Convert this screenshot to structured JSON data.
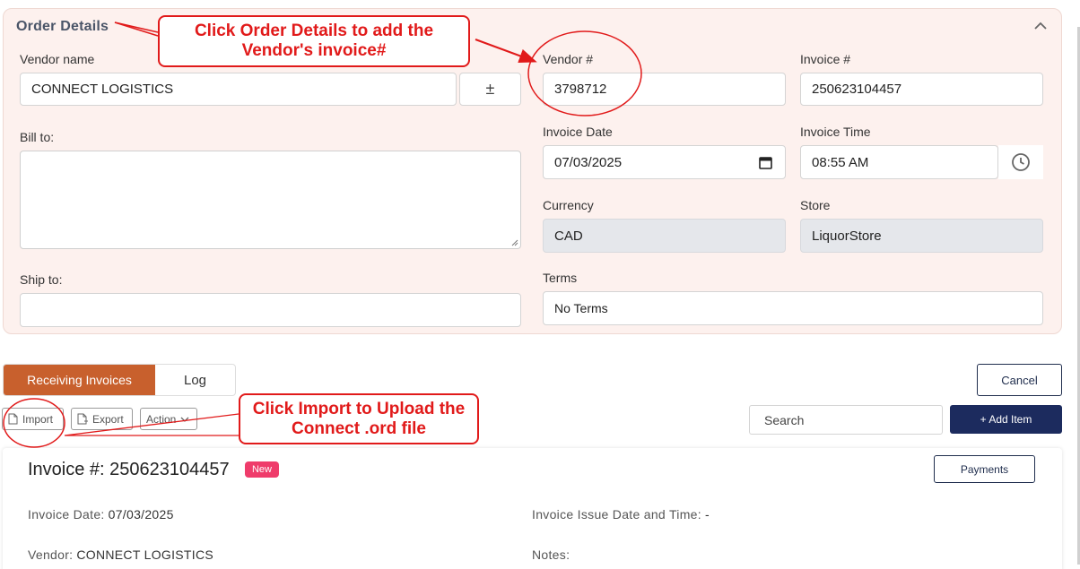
{
  "order_details": {
    "title": "Order Details",
    "vendor_name_label": "Vendor name",
    "vendor_name_value": "CONNECT LOGISTICS",
    "vendor_toggle_label": "±",
    "vendor_num_label": "Vendor #",
    "vendor_num_value": "3798712",
    "invoice_num_label": "Invoice #",
    "invoice_num_value": "250623104457",
    "bill_to_label": "Bill to:",
    "invoice_date_label": "Invoice Date",
    "invoice_date_value": "07/03/2025",
    "invoice_time_label": "Invoice Time",
    "invoice_time_value": "08:55 AM",
    "currency_label": "Currency",
    "currency_value": "CAD",
    "store_label": "Store",
    "store_value": "LiquorStore",
    "ship_to_label": "Ship to:",
    "terms_label": "Terms",
    "terms_value": "No Terms"
  },
  "tabs": [
    "Receiving Invoices",
    "Log"
  ],
  "toolbar": {
    "import": "Import",
    "export": "Export",
    "action": "Action",
    "search_placeholder": "Search",
    "add_item": "+ Add Item",
    "cancel": "Cancel"
  },
  "invoice_card": {
    "title": "Invoice #: 250623104457",
    "badge": "New",
    "payments": "Payments",
    "date_label": "Invoice Date:",
    "date_value": "07/03/2025",
    "issue_label": "Invoice Issue Date and Time:",
    "issue_value": "-",
    "vendor_label": "Vendor:",
    "vendor_value": "CONNECT LOGISTICS",
    "notes_label": "Notes:"
  },
  "annotations": {
    "order_callout_line1": "Click Order Details to add the",
    "order_callout_line2": "Vendor's invoice#",
    "import_callout_line1": "Click Import to Upload the",
    "import_callout_line2": "Connect .ord file"
  },
  "colors": {
    "panel_bg": "#fdf1ee",
    "active_tab": "#c8602d",
    "primary_button": "#1c2b5e",
    "badge": "#ef3c6b",
    "annotation": "#e11a1a"
  }
}
